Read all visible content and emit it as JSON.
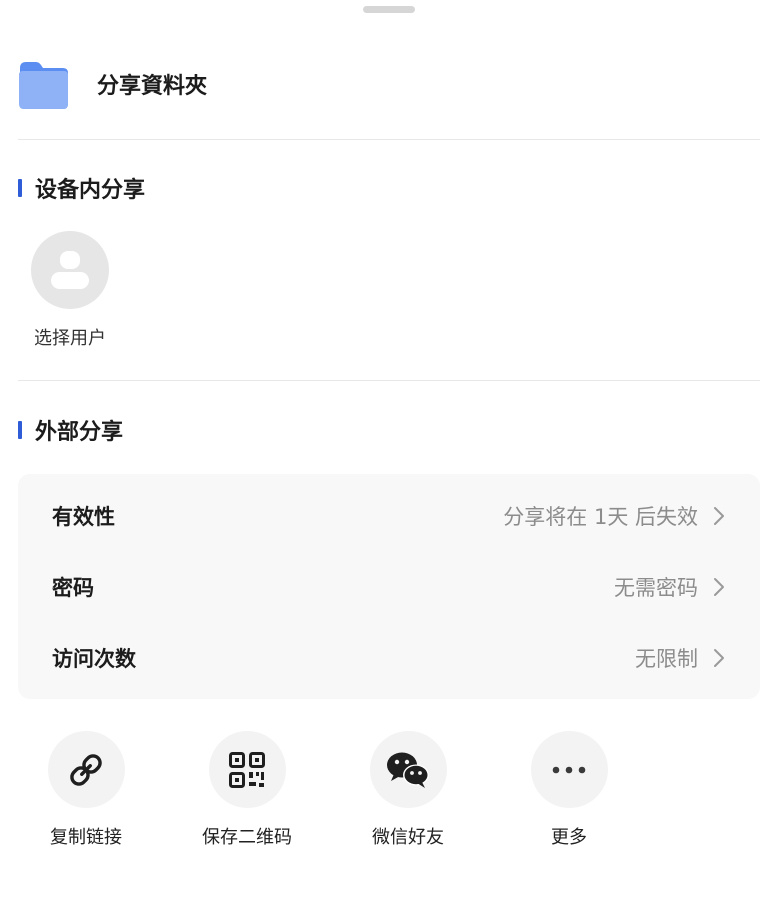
{
  "header": {
    "title": "分享資料夾",
    "folder_icon": "folder-icon"
  },
  "device_share": {
    "title": "设备内分享",
    "select_user_label": "选择用户"
  },
  "external_share": {
    "title": "外部分享",
    "rows": [
      {
        "label": "有效性",
        "value": "分享将在 1天 后失效"
      },
      {
        "label": "密码",
        "value": "无需密码"
      },
      {
        "label": "访问次数",
        "value": "无限制"
      }
    ]
  },
  "actions": [
    {
      "label": "复制链接",
      "icon": "link-icon"
    },
    {
      "label": "保存二维码",
      "icon": "qr-code-icon"
    },
    {
      "label": "微信好友",
      "icon": "wechat-icon"
    },
    {
      "label": "更多",
      "icon": "more-icon"
    }
  ],
  "colors": {
    "accent": "#2f5dd8",
    "folder_top": "#5b8ef0",
    "folder_body": "#8fb2f7",
    "muted_text": "#8c8c8c",
    "card_bg": "#f8f8f8"
  }
}
